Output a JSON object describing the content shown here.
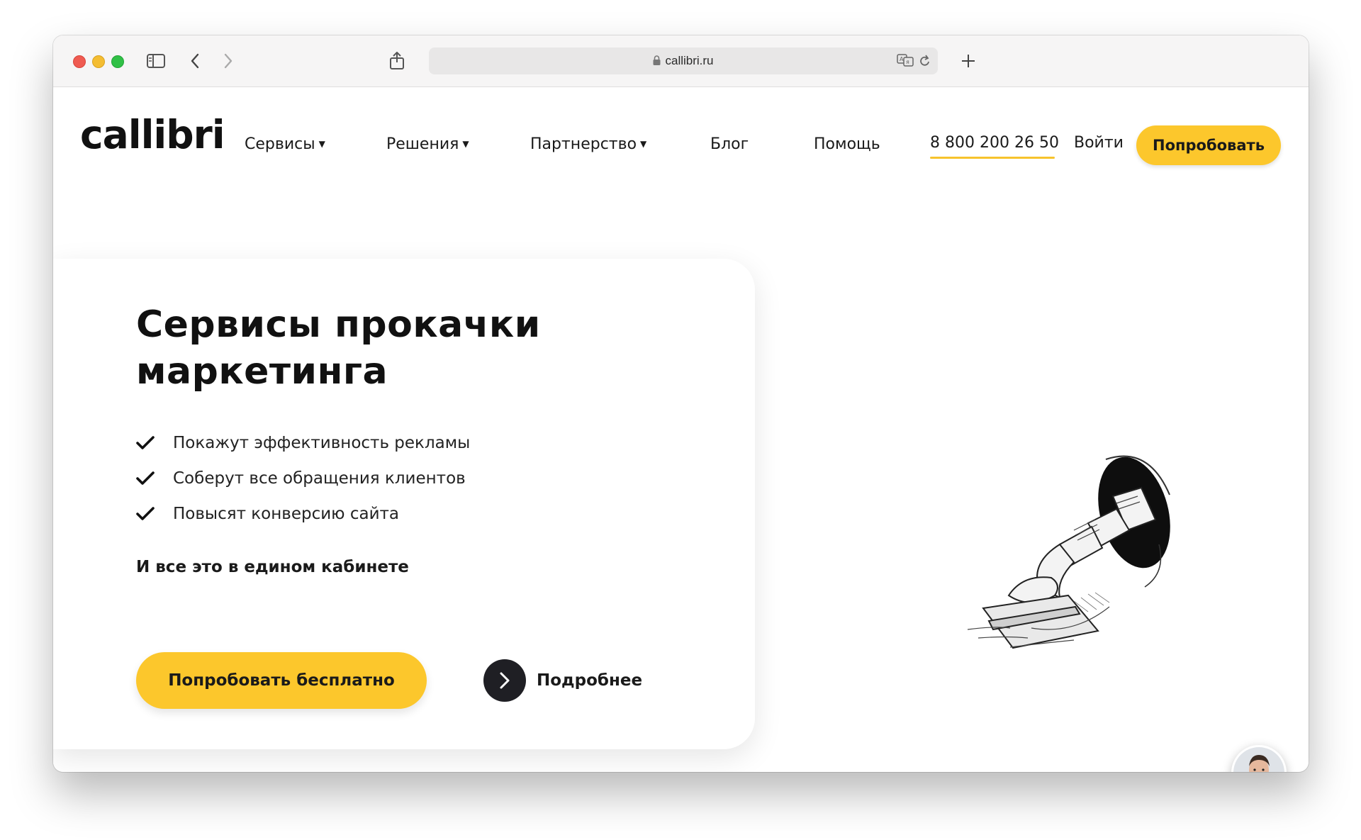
{
  "browser": {
    "url": "callibri.ru",
    "icons": [
      "sidebar-icon",
      "back-arrow-icon",
      "forward-arrow-icon",
      "share-icon",
      "lock-icon",
      "translate-icon",
      "reload-icon",
      "new-tab-plus-icon"
    ]
  },
  "header": {
    "logo_text": "callibri",
    "nav": [
      {
        "label": "Сервисы",
        "has_dropdown": true
      },
      {
        "label": "Решения",
        "has_dropdown": true
      },
      {
        "label": "Партнерство",
        "has_dropdown": true
      },
      {
        "label": "Блог",
        "has_dropdown": false
      },
      {
        "label": "Помощь",
        "has_dropdown": false
      }
    ],
    "phone": "8 800 200 26 50",
    "login": "Войти",
    "try_button": "Попробовать"
  },
  "hero": {
    "title_line1": "Сервисы прокачки",
    "title_line2": "маркетинга",
    "features": [
      "Покажут эффективность рекламы",
      "Соберут все обращения клиентов",
      "Повысят конверсию сайта"
    ],
    "subtitle": "И все это в едином кабинете",
    "cta_button": "Попробовать бесплатно",
    "more_link": "Подробнее"
  },
  "colors": {
    "accent_yellow": "#fcc72c",
    "dark": "#1f1f24",
    "text": "#111111"
  }
}
